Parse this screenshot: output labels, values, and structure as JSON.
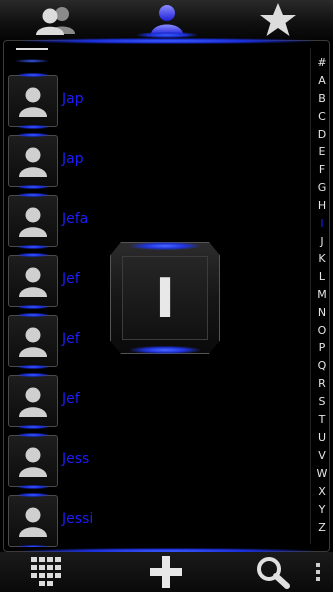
{
  "tabs": [
    {
      "id": "groups",
      "icon": "groups-icon"
    },
    {
      "id": "contacts",
      "icon": "contact-icon",
      "selected": true
    },
    {
      "id": "favorites",
      "icon": "star-icon"
    }
  ],
  "contacts": [
    {
      "name": "Jap"
    },
    {
      "name": "Jap"
    },
    {
      "name": "Jefa"
    },
    {
      "name": "Jef"
    },
    {
      "name": "Jef"
    },
    {
      "name": "Jef"
    },
    {
      "name": "Jess"
    },
    {
      "name": "Jessi"
    }
  ],
  "index_overlay": {
    "letter": "I"
  },
  "alphabet": {
    "letters": [
      "#",
      "A",
      "B",
      "C",
      "D",
      "E",
      "F",
      "G",
      "H",
      "I",
      "J",
      "K",
      "L",
      "M",
      "N",
      "O",
      "P",
      "Q",
      "R",
      "S",
      "T",
      "U",
      "V",
      "W",
      "X",
      "Y",
      "Z"
    ],
    "active": "I"
  },
  "bottom_actions": [
    {
      "id": "dialpad",
      "icon": "dialpad-icon"
    },
    {
      "id": "add",
      "icon": "plus-icon"
    },
    {
      "id": "search",
      "icon": "search-icon"
    },
    {
      "id": "menu",
      "icon": "overflow-menu-icon"
    }
  ],
  "colors": {
    "accent": "#1c1cff",
    "glow": "#3a5cff",
    "text": "#e6e6e6",
    "background": "#000000"
  }
}
